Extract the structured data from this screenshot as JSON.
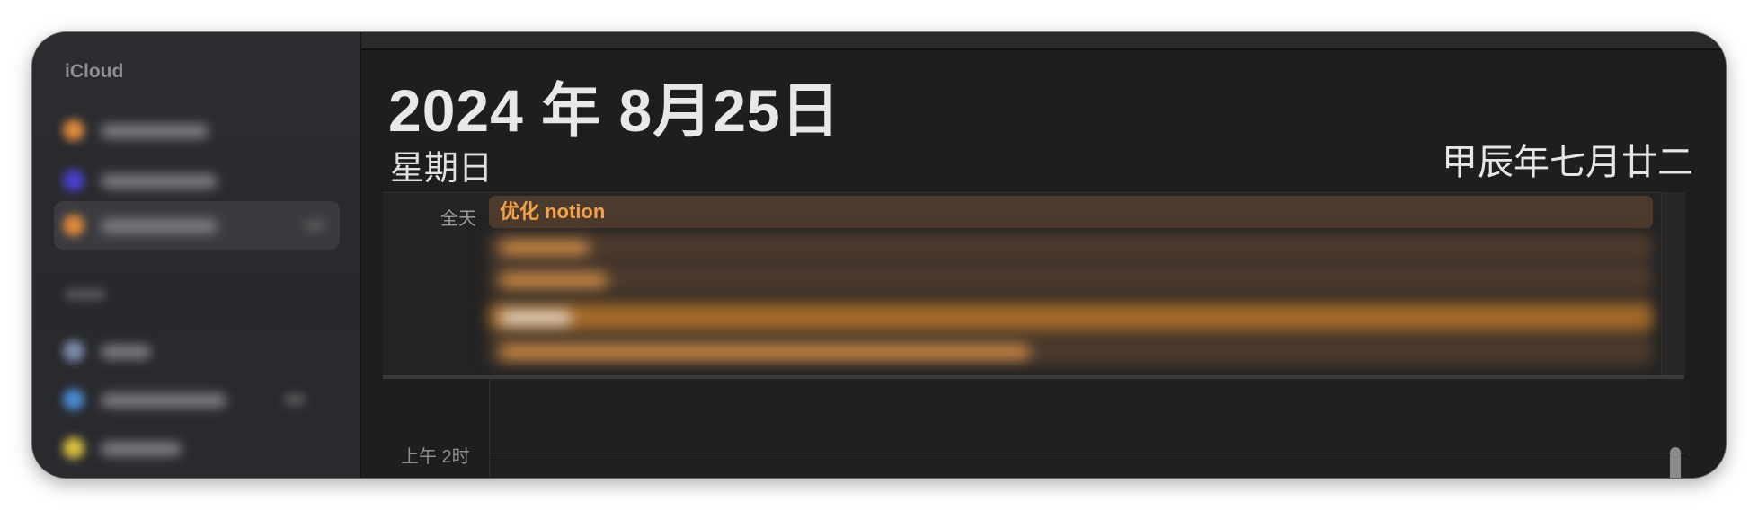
{
  "sidebar": {
    "section_title": "iCloud",
    "calendars": [
      {
        "color": "#e08a3c"
      },
      {
        "color": "#4a3fd0"
      },
      {
        "color": "#e08a3c",
        "selected": true
      },
      {
        "color": "#7a8aa8"
      },
      {
        "color": "#4a8ad0"
      },
      {
        "color": "#d8c040"
      }
    ]
  },
  "header": {
    "date": "2024 年 8月25日",
    "weekday": "星期日",
    "lunar": "甲辰年七月廿二"
  },
  "allday": {
    "label": "全天",
    "first_event": "优化 notion"
  },
  "timeline": {
    "first_label": "上午 2时"
  },
  "colors": {
    "accent_orange": "#f3a24a",
    "event_bg": "#4c3a2d"
  }
}
